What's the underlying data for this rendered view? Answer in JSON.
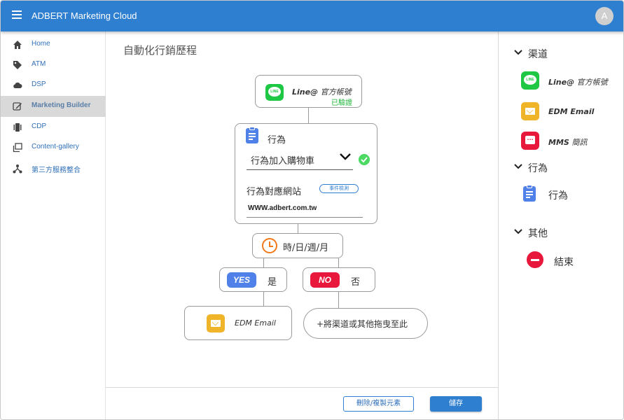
{
  "app": {
    "title": "ADBERT Marketing Cloud",
    "avatar_letter": "A"
  },
  "sidebar": {
    "items": [
      {
        "label": "Home",
        "icon": "home-icon"
      },
      {
        "label": "ATM",
        "icon": "tag-icon"
      },
      {
        "label": "DSP",
        "icon": "cloud-icon"
      },
      {
        "label": "Marketing Builder",
        "icon": "builder-icon",
        "active": true
      },
      {
        "label": "CDP",
        "icon": "cdp-icon"
      },
      {
        "label": "Content-gallery",
        "icon": "gallery-icon"
      },
      {
        "label": "第三方服務整合",
        "icon": "integration-icon"
      }
    ]
  },
  "main": {
    "page_title": "自動化行銷歷程",
    "line_node": {
      "name_latin": "Line@",
      "name_cjk": " 官方帳號",
      "status": "已驗證"
    },
    "action_node": {
      "title": "行為",
      "selected": "行為加入購物車",
      "site_label": "行為對應網站",
      "detect_label": "事件檢測",
      "url": "WWW.adbert.com.tw"
    },
    "time_node": {
      "label": "時/日/週/月"
    },
    "yes_node": {
      "pill": "YES",
      "text": "是"
    },
    "no_node": {
      "pill": "NO",
      "text": "否"
    },
    "edm_node": {
      "name": "EDM Email"
    },
    "drop_node": {
      "label": "+將渠道或其他拖曳至此"
    },
    "footer": {
      "delete_copy_label": "刪除/複製元素",
      "save_label": "儲存"
    }
  },
  "palette": {
    "channels": {
      "heading": "渠道",
      "items": [
        {
          "latin": "Line@",
          "cjk": " 官方帳號"
        },
        {
          "latin": "EDM Email",
          "cjk": ""
        },
        {
          "latin": "MMS",
          "cjk": " 簡訊"
        }
      ]
    },
    "actions": {
      "heading": "行為",
      "item": "行為"
    },
    "others": {
      "heading": "其他",
      "item": "結束"
    }
  },
  "colors": {
    "topbar": "#2f7fd1",
    "line_green": "#1ec845",
    "yes_blue": "#4f81e9",
    "no_red": "#e8183c",
    "email_yellow": "#f0b429",
    "clock_orange": "#f07a1a"
  }
}
